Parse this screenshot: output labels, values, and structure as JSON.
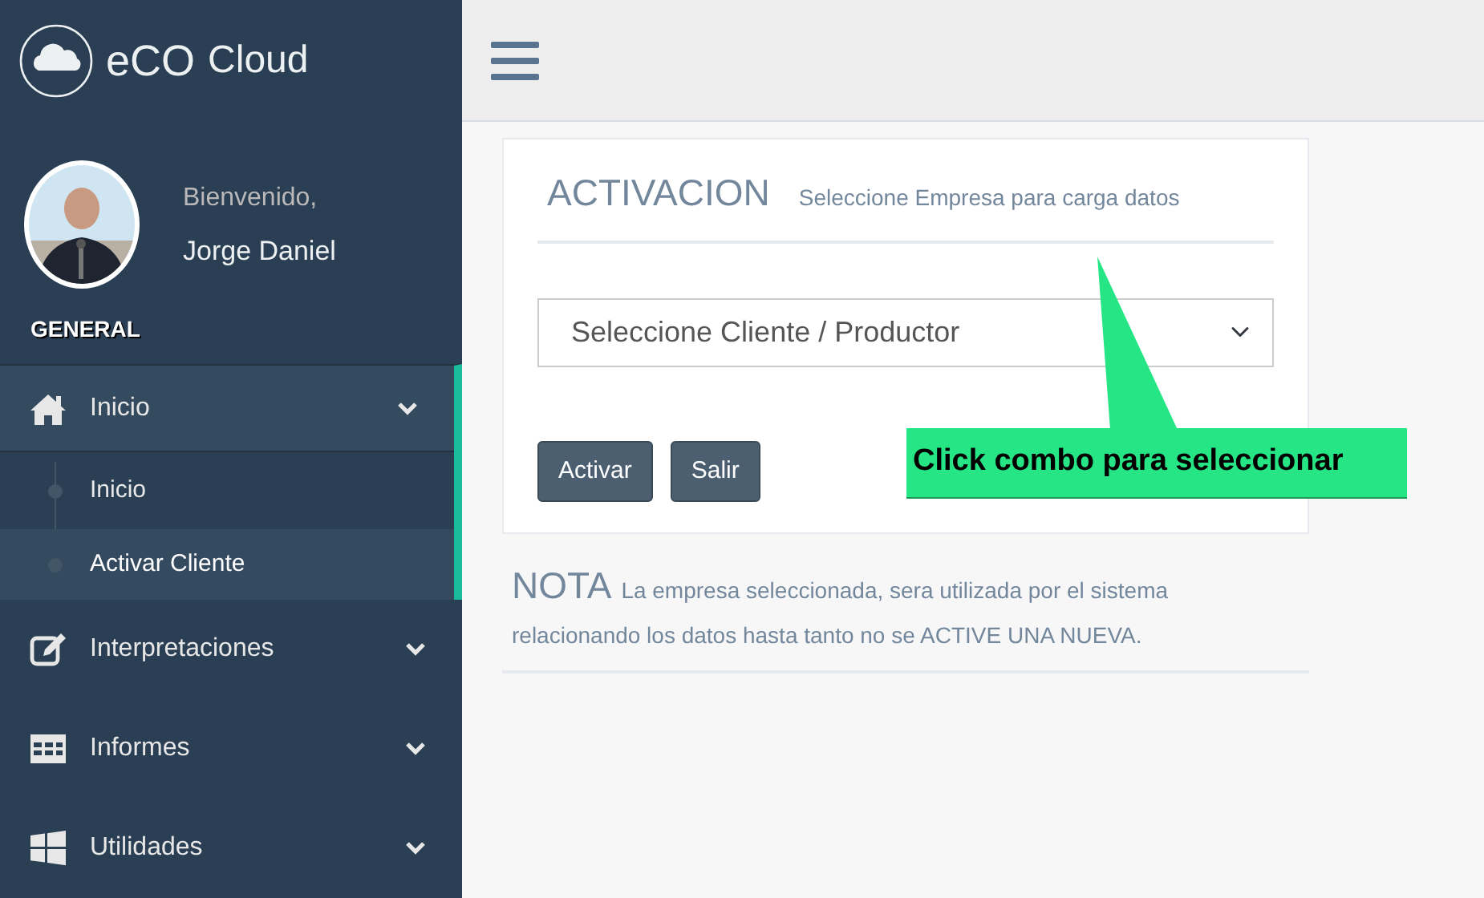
{
  "sidebar": {
    "brand": {
      "main": "eCO",
      "suffix": "Cloud"
    },
    "profile": {
      "greeting": "Bienvenido,",
      "name": "Jorge Daniel"
    },
    "section": "GENERAL",
    "menu": [
      {
        "label": "Inicio",
        "expanded": true,
        "selected": true,
        "children": [
          {
            "label": "Inicio",
            "selected": false
          },
          {
            "label": "Activar Cliente",
            "selected": true
          }
        ]
      },
      {
        "label": "Interpretaciones",
        "expanded": false,
        "selected": false
      },
      {
        "label": "Informes",
        "expanded": false,
        "selected": false
      },
      {
        "label": "Utilidades",
        "expanded": false,
        "selected": false
      }
    ]
  },
  "panel": {
    "title": "ACTIVACION",
    "subtitle": "Seleccione Empresa para carga datos",
    "select": {
      "placeholder": "Seleccione Cliente / Productor"
    },
    "buttons": [
      "Activar",
      "Salir"
    ]
  },
  "callout": "Click combo para seleccionar",
  "note": {
    "title": "NOTA",
    "text": "La empresa seleccionada, sera utilizada por el sistema relacionando los datos hasta tanto no se ACTIVE UNA NUEVA."
  }
}
